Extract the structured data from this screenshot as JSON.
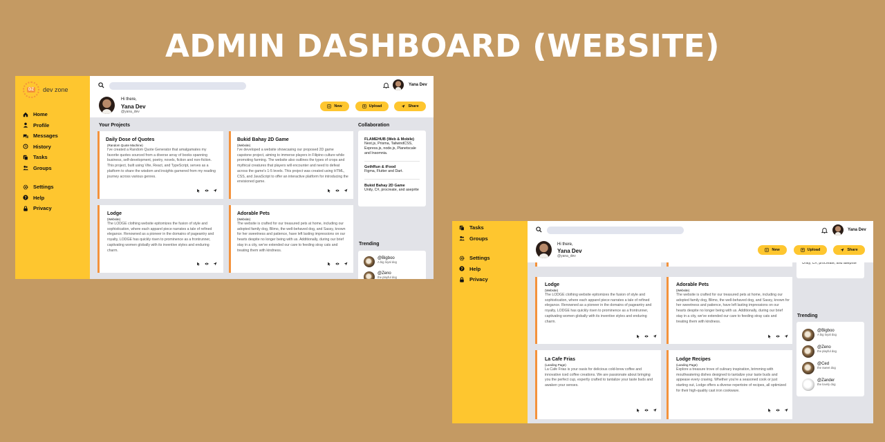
{
  "page": {
    "title": "ADMIN DASHBOARD (WEBSITE)"
  },
  "brand": {
    "logo_text": "DZ",
    "name": "dev zone"
  },
  "user": {
    "greeting": "Hi there,",
    "name": "Yana Dev",
    "handle": "@yana_dev"
  },
  "actions": {
    "new": "New",
    "upload": "Upload",
    "share": "Share"
  },
  "nav": {
    "home": "Home",
    "profile": "Profile",
    "messages": "Messages",
    "history": "History",
    "tasks": "Tasks",
    "groups": "Groups",
    "settings": "Settings",
    "help": "Help",
    "privacy": "Privacy"
  },
  "sections": {
    "projects": "Your Projects",
    "collaboration": "Collaboration",
    "trending": "Trending"
  },
  "projects": {
    "daily": {
      "title": "Daily Dose of Quotes",
      "subtitle": "(Random Quote Machine)",
      "body": "I've created a Random Quote Generator that amalgamates my favorite quotes sourced from a diverse array of books spanning business, self-development, poetry, novels, fiction and non-fiction. This project, built using Vite, React, and TypeScript, serves as a platform to share the wisdom and insights garnered from my reading journey across various genres."
    },
    "bukid": {
      "title": "Bukid Bahay 2D Game",
      "subtitle": "(Website)",
      "body": "I've developed a website showcasing our proposed 2D game capstone project, aiming to immerse players in Filipino culture while promoting farming. The website also outlines the types of crops and mythical creatures that players will encounter and need to defeat across the game's 1-5 levels. This project was created using HTML, CSS, and JavaScript to offer an interactive platform for introducing the envisioned game."
    },
    "lodge": {
      "title": "Lodge",
      "subtitle": "(Website)",
      "body": "The LODGE clothing website epitomizes the fusion of style and sophistication, where each apparel piece narrates a tale of refined elegance. Renowned as a pioneer in the domains of pageantry and royalty, LODGE has quickly risen to prominence as a frontrunner, captivating women globally with its inventive styles and enduring charm."
    },
    "pets": {
      "title": "Adorable Pets",
      "subtitle": "(Website)",
      "body": "The website is crafted for our treasured pets at home, including our adopted family dog, Blimo, the well-behaved dog, and Sassy, known for her sweetness and patience, have left lasting impressions on our hearts despite no longer being with us. Additionally, during our brief stay in a city, we've extended our care to feeding stray cats and treating them with kindness."
    },
    "cafe": {
      "title": "La Cafe Frias",
      "subtitle": "(Landing Page)",
      "body": "La Cafe Frias is your oasis for delicious cold-brew coffee and innovative iced coffee creations. We are passionate about bringing you the perfect cup, expertly crafted to tantalize your taste buds and awaken your senses."
    },
    "lodge_recipes": {
      "title": "Lodge Recipes",
      "subtitle": "(Landing Page)",
      "body": "Explore a treasure trove of culinary inspiration, brimming with mouthwatering dishes designed to tantalize your taste buds and appease every craving. Whether you're a seasoned cook or just starting out, Lodge offers a diverse repertoire of recipes, all optimized for their high-quality cast iron cookware."
    }
  },
  "collaboration": [
    {
      "name": "FLAMEHUB (Web & Mobile)",
      "tech": "Next.js, Prisma, TailwindCSS, Express.js, node.js, Planetscale and Insomnia."
    },
    {
      "name": "GethRun & iFood",
      "tech": "Figma, Flutter and Dart."
    },
    {
      "name": "Bukid Bahay 2D Game",
      "tech": "Unity, C#, procreate, and aseprite"
    }
  ],
  "collab_fragment": "Unity, C#, procreate, and aseprite",
  "trending": [
    {
      "name": "@Bigboo",
      "desc": "A big loyal dog"
    },
    {
      "name": "@Zeno",
      "desc": "the playful dog"
    },
    {
      "name": "@Ced",
      "desc": "the sweet dog"
    },
    {
      "name": "@Zander",
      "desc": "the lovely dog"
    }
  ],
  "colors": {
    "background": "#c49a63",
    "sidebar": "#fec62f",
    "accent": "#f4923b",
    "content_bg": "#e2e3e8"
  }
}
